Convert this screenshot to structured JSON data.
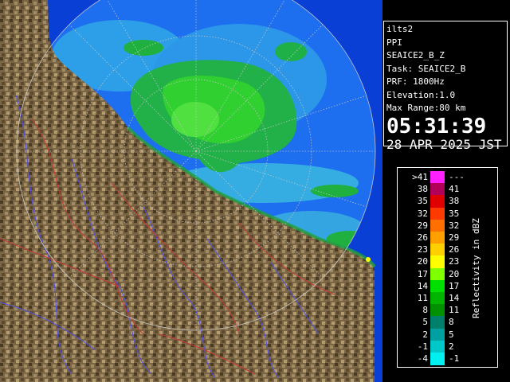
{
  "info": {
    "site": "ilts2",
    "product": "PPI",
    "scan_id": "SEAICE2_B_Z",
    "task": "Task: SEAICE2_B",
    "prf": "PRF: 1800Hz",
    "elevation": "Elevation:1.0",
    "max_range": "Max Range:80 km",
    "time": "05:31:39",
    "date": "28 APR 2025 JST"
  },
  "legend": {
    "title": "Reflectivity in dBZ",
    "rows": [
      {
        "lo": ">41",
        "hi": "---",
        "color": "#ff20ff"
      },
      {
        "lo": "38",
        "hi": "41",
        "color": "#b0005a"
      },
      {
        "lo": "35",
        "hi": "38",
        "color": "#e00000"
      },
      {
        "lo": "32",
        "hi": "35",
        "color": "#ff3a00"
      },
      {
        "lo": "29",
        "hi": "32",
        "color": "#ff7000"
      },
      {
        "lo": "26",
        "hi": "29",
        "color": "#ffa000"
      },
      {
        "lo": "23",
        "hi": "26",
        "color": "#ffd000"
      },
      {
        "lo": "20",
        "hi": "23",
        "color": "#ffff00"
      },
      {
        "lo": "17",
        "hi": "20",
        "color": "#80ff00"
      },
      {
        "lo": "14",
        "hi": "17",
        "color": "#00e000"
      },
      {
        "lo": "11",
        "hi": "14",
        "color": "#00b400"
      },
      {
        "lo": "8",
        "hi": "11",
        "color": "#009000"
      },
      {
        "lo": "5",
        "hi": "8",
        "color": "#00806a"
      },
      {
        "lo": "2",
        "hi": "5",
        "color": "#00a0a0"
      },
      {
        "lo": "-1",
        "hi": "2",
        "color": "#00c8c8"
      },
      {
        "lo": "-4",
        "hi": "-1",
        "color": "#00f0f0"
      }
    ]
  },
  "colors": {
    "ocean": "#0a3fd6",
    "radar_disc": "#1e6ef0",
    "land_dark": "#4a3a22",
    "land_light": "#a08a62",
    "rivers": "#4a4ae0",
    "borders": "#c03030"
  }
}
